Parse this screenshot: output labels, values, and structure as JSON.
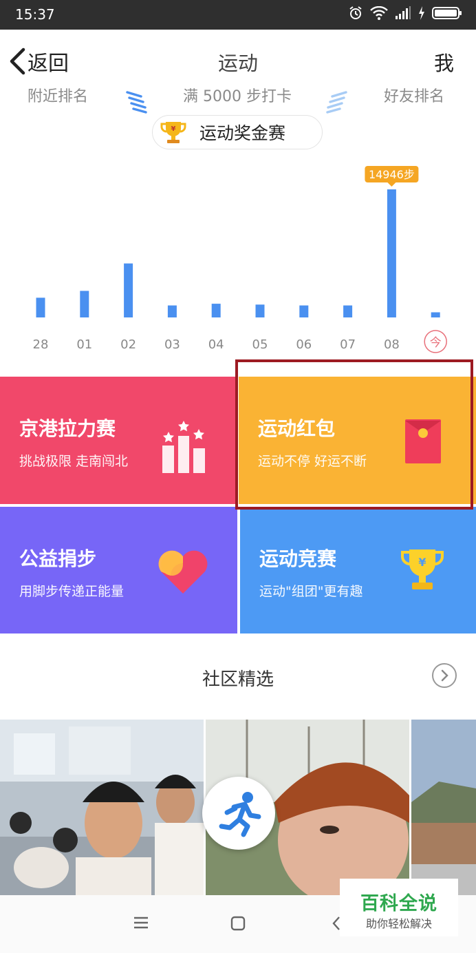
{
  "status_bar": {
    "time": "15:37"
  },
  "header": {
    "back_label": "返回",
    "title": "运动",
    "me_label": "我"
  },
  "subtabs": {
    "left": "附近排名",
    "center": "满 5000 步打卡",
    "right": "好友排名"
  },
  "prize": {
    "label": "运动奖金赛",
    "trophy_mark": "¥"
  },
  "chart_data": {
    "type": "bar",
    "categories": [
      "28",
      "01",
      "02",
      "03",
      "04",
      "05",
      "06",
      "07",
      "08",
      "今"
    ],
    "values": [
      2300,
      3100,
      6300,
      1400,
      1600,
      1500,
      1400,
      1400,
      14946,
      600
    ],
    "highlight": {
      "index": 8,
      "label": "14946步"
    },
    "bar_color": "#4a90f0",
    "tooltip_color": "#f5a623",
    "today_color": "#e8707a"
  },
  "tiles": [
    {
      "title": "京港拉力赛",
      "subtitle": "挑战极限 走南闯北",
      "color": "#f1486a"
    },
    {
      "title": "运动红包",
      "subtitle": "运动不停 好运不断",
      "color": "#fab334"
    },
    {
      "title": "公益捐步",
      "subtitle": "用脚步传递正能量",
      "color": "#7766f7"
    },
    {
      "title": "运动竞赛",
      "subtitle": "运动\"组团\"更有趣",
      "color": "#4d9af4",
      "trophy_mark": "¥"
    }
  ],
  "section": {
    "title": "社区精选"
  },
  "watermark": {
    "title": "百科全说",
    "subtitle": "助你轻松解决"
  }
}
